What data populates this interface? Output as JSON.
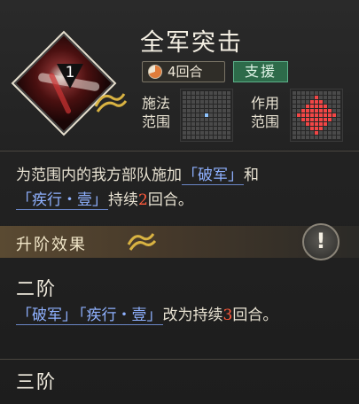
{
  "skill": {
    "title": "全军突击",
    "level": "1",
    "turns": "4回合",
    "type": "支援",
    "cast_range_label": "施法\n范围",
    "effect_range_label": "作用\n范围"
  },
  "description": {
    "pre": "为范围内的我方部队施加",
    "buff1": "「破军」",
    "mid": "和",
    "buff2": "「疾行・壹」",
    "duration_pre": "持续",
    "duration_num": "2",
    "duration_post": "回合。"
  },
  "upgrade": {
    "section_title": "升阶效果",
    "stage2_title": "二阶",
    "stage2_buff1": "「破军」",
    "stage2_buff2": "「疾行・壹」",
    "stage2_pre": "改为持续",
    "stage2_num": "3",
    "stage2_post": "回合。",
    "stage3_title": "三阶"
  },
  "colors": {
    "support_badge": "#2d6b4a",
    "link_blue": "#8fb1ff",
    "highlight_red": "#ff5a3c",
    "cast_cell": "#8fc4ff",
    "effect_cell": "#f24646"
  }
}
